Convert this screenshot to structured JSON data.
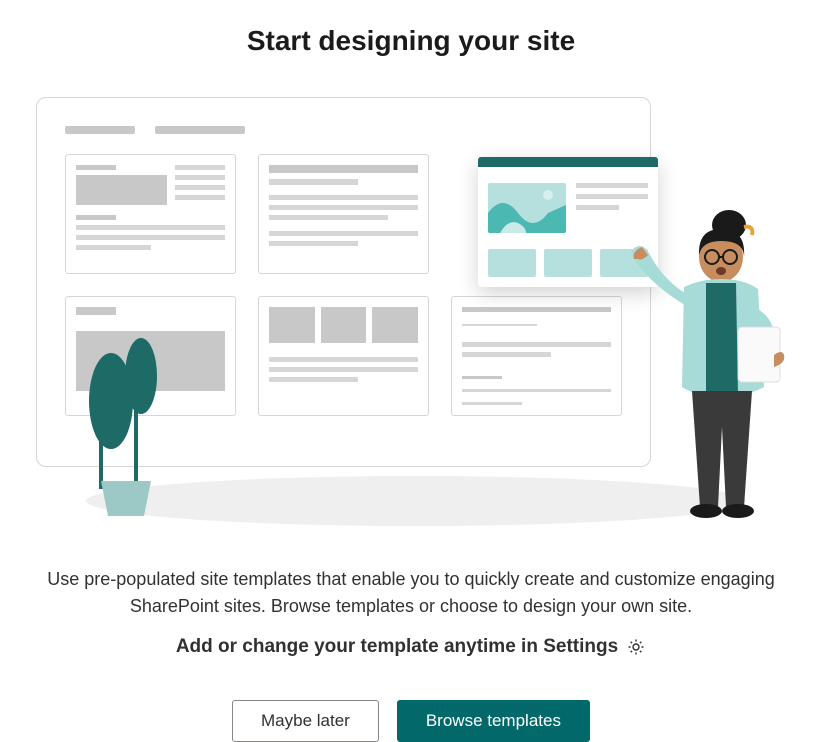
{
  "title": "Start designing your site",
  "description": "Use pre-populated site templates that enable you to quickly create and customize engaging SharePoint sites. Browse templates or choose to design your own site.",
  "settings_line": "Add or change your template anytime in Settings",
  "buttons": {
    "secondary": "Maybe later",
    "primary": "Browse templates"
  },
  "colors": {
    "accent": "#03686a",
    "illustration_teal": "#1e6a67",
    "illustration_light": "#b5e0dd"
  }
}
